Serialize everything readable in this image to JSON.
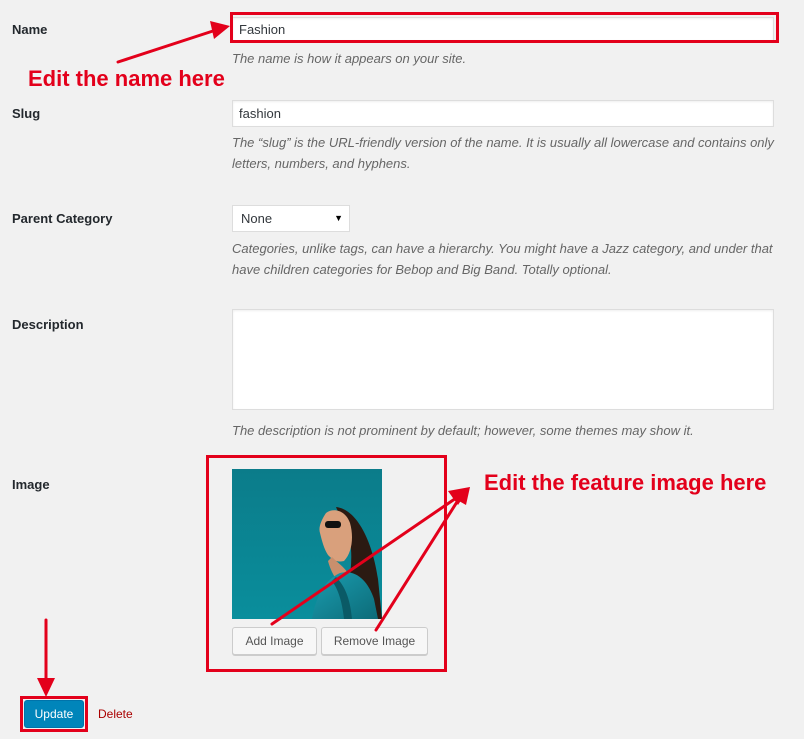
{
  "form": {
    "name": {
      "label": "Name",
      "value": "Fashion",
      "description": "The name is how it appears on your site."
    },
    "slug": {
      "label": "Slug",
      "value": "fashion",
      "description_line1": "The “slug” is the URL-friendly version of the name. It is usually all lowercase and contains only",
      "description_line2": "letters, numbers, and hyphens."
    },
    "parent": {
      "label": "Parent Category",
      "selected": "None",
      "description_line1": "Categories, unlike tags, can have a hierarchy. You might have a Jazz category, and under that",
      "description_line2": "have children categories for Bebop and Big Band. Totally optional."
    },
    "description": {
      "label": "Description",
      "value": "",
      "description": "The description is not prominent by default; however, some themes may show it."
    },
    "image": {
      "label": "Image",
      "add_button": "Add Image",
      "remove_button": "Remove Image"
    }
  },
  "actions": {
    "update_label": "Update",
    "delete_label": "Delete"
  },
  "annotations": {
    "name_note": "Edit the name here",
    "image_note": "Edit the feature image here"
  },
  "colors": {
    "annotation_red": "#e3001b",
    "primary_blue": "#0085ba",
    "delete_red": "#aa0000",
    "photo_teal": "#0a8696"
  }
}
